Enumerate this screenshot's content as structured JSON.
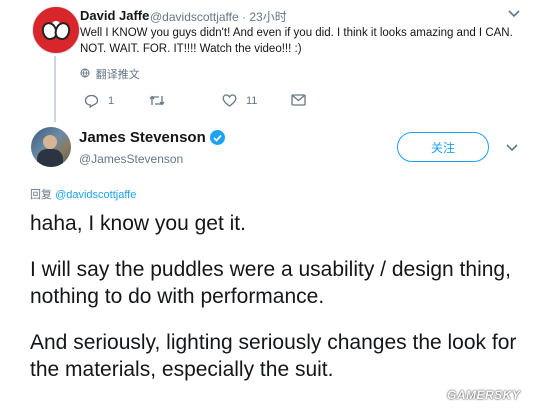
{
  "parent_tweet": {
    "name": "David Jaffe",
    "handle_time": "@davidscottjaffe · 23小时",
    "text": "Well I KNOW you guys didn't! And even if you did. I think it looks amazing and I CAN. NOT. WAIT. FOR. IT!!!! Watch the video!!! :)",
    "translate_label": "翻译推文",
    "reply_count": "1",
    "retweet_count": "",
    "like_count": "11"
  },
  "main_tweet": {
    "name": "James Stevenson",
    "handle": "@JamesStevenson",
    "follow_label": "关注",
    "reply_prefix": "回复",
    "reply_mention": "@davidscottjaffe",
    "paragraphs": [
      "haha, I know you get it.",
      "I will say the puddles were a usability / design thing, nothing to do with performance.",
      "And seriously, lighting seriously changes the look for the materials, especially the suit."
    ]
  },
  "watermark": "GAMERSKY",
  "icons": {
    "caret": "chevron-down-icon",
    "reply": "reply-icon",
    "retweet": "retweet-icon",
    "like": "heart-icon",
    "dm": "envelope-icon",
    "verified": "verified-badge-icon",
    "translate": "globe-icon"
  },
  "colors": {
    "accent": "#1da1f2",
    "secondary_text": "#657786",
    "primary_text": "#14171a"
  }
}
